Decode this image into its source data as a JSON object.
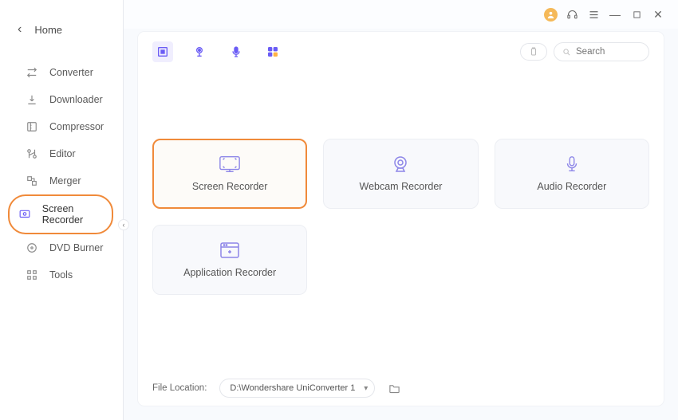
{
  "app": {
    "home_label": "Home"
  },
  "sidebar": {
    "items": [
      {
        "label": "Converter"
      },
      {
        "label": "Downloader"
      },
      {
        "label": "Compressor"
      },
      {
        "label": "Editor"
      },
      {
        "label": "Merger"
      },
      {
        "label": "Screen Recorder"
      },
      {
        "label": "DVD Burner"
      },
      {
        "label": "Tools"
      }
    ]
  },
  "search": {
    "placeholder": "Search"
  },
  "recorders": [
    {
      "label": "Screen Recorder"
    },
    {
      "label": "Webcam Recorder"
    },
    {
      "label": "Audio Recorder"
    },
    {
      "label": "Application Recorder"
    }
  ],
  "footer": {
    "location_label": "File Location:",
    "location_value": "D:\\Wondershare UniConverter 1"
  }
}
